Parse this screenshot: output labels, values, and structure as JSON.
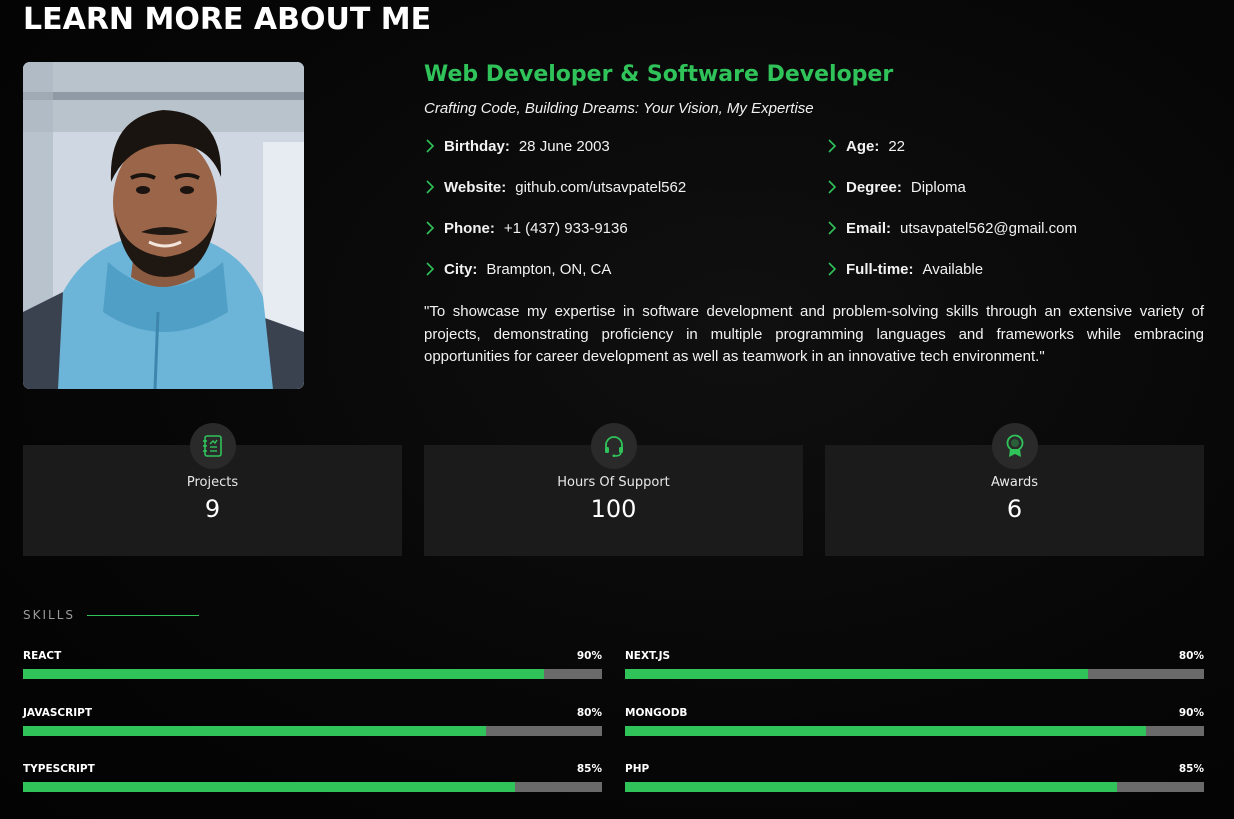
{
  "section_title": "LEARN MORE ABOUT ME",
  "profile": {
    "role": "Web Developer & Software Developer",
    "tagline": "Crafting Code, Building Dreams: Your Vision, My Expertise",
    "facts_left": [
      {
        "key": "Birthday:",
        "value": "28 June 2003"
      },
      {
        "key": "Website:",
        "value": "github.com/utsavpatel562"
      },
      {
        "key": "Phone:",
        "value": "+1 (437) 933-9136"
      },
      {
        "key": "City:",
        "value": "Brampton, ON, CA"
      }
    ],
    "facts_right": [
      {
        "key": "Age:",
        "value": "22"
      },
      {
        "key": "Degree:",
        "value": "Diploma"
      },
      {
        "key": "Email:",
        "value": "utsavpatel562@gmail.com"
      },
      {
        "key": "Full-time:",
        "value": "Available"
      }
    ],
    "objective": "\"To showcase my expertise in software development and problem-solving skills through an extensive variety of projects, demonstrating proficiency in multiple programming languages and frameworks while embracing opportunities for career development as well as teamwork in an innovative tech environment.\""
  },
  "counters": [
    {
      "label": "Projects",
      "value": "9",
      "icon": "document-list-icon"
    },
    {
      "label": "Hours Of Support",
      "value": "100",
      "icon": "headset-icon"
    },
    {
      "label": "Awards",
      "value": "6",
      "icon": "award-ribbon-icon"
    }
  ],
  "skills": {
    "heading": "SKILLS",
    "left": [
      {
        "name": "REACT",
        "percent_label": "90%",
        "percent": 90
      },
      {
        "name": "JAVASCRIPT",
        "percent_label": "80%",
        "percent": 80
      },
      {
        "name": "TYPESCRIPT",
        "percent_label": "85%",
        "percent": 85
      }
    ],
    "right": [
      {
        "name": "NEXT.JS",
        "percent_label": "80%",
        "percent": 80
      },
      {
        "name": "MONGODB",
        "percent_label": "90%",
        "percent": 90
      },
      {
        "name": "PHP",
        "percent_label": "85%",
        "percent": 85
      }
    ]
  },
  "colors": {
    "accent": "#2fc35a",
    "background": "#050505",
    "card": "#1b1b1b",
    "track": "#6a6a6a"
  }
}
